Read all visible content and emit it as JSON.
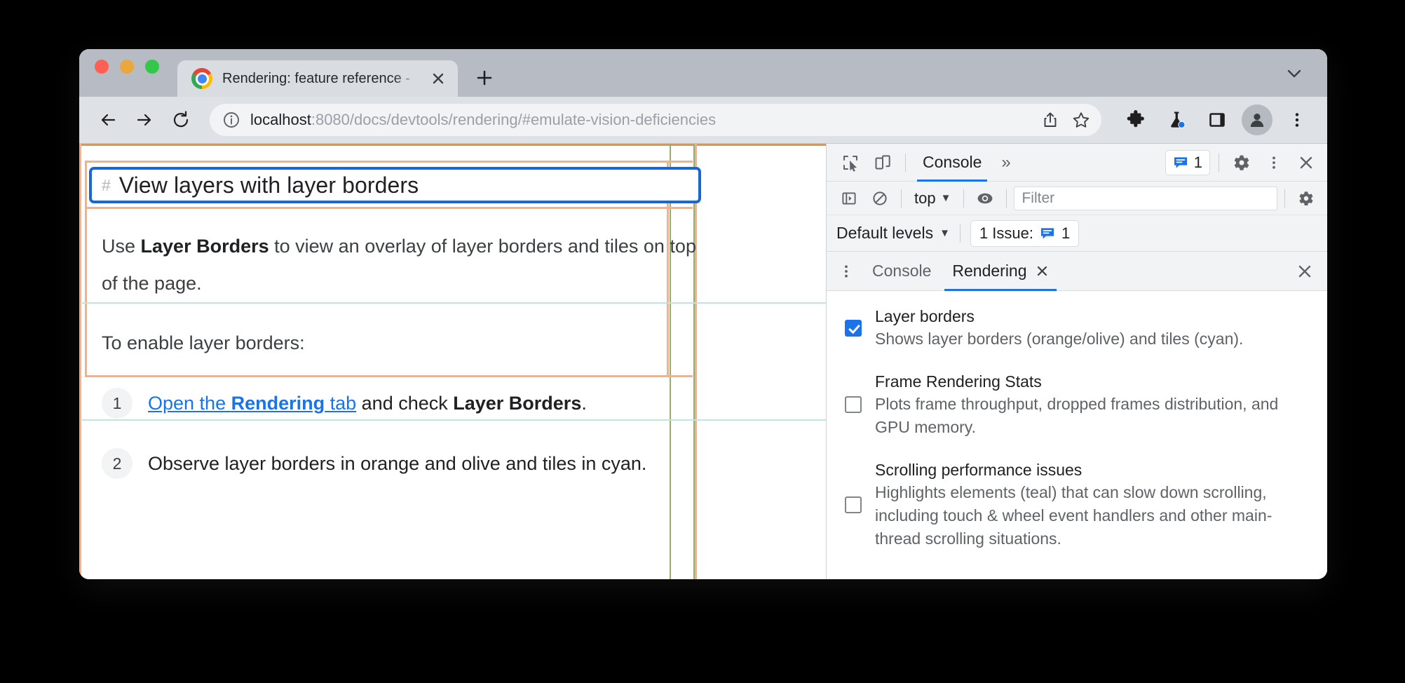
{
  "window": {
    "traffic_lights": [
      "close",
      "minimize",
      "zoom"
    ],
    "tab": {
      "title": "Rendering: feature reference -",
      "favicon": "chrome-logo",
      "close_label": "✕"
    },
    "new_tab_label": "+",
    "tab_list_caret": "⌄"
  },
  "toolbar": {
    "back": "←",
    "forward": "→",
    "reload": "⟳",
    "omnibox": {
      "info_icon": "info-icon",
      "url_host": "localhost",
      "url_rest": ":8080/docs/devtools/rendering/#emulate-vision-deficiencies",
      "full_url": "localhost:8080/docs/devtools/rendering/#emulate-vision-deficiencies",
      "share_icon": "share-icon",
      "bookmark_icon": "star-icon"
    },
    "extensions_icon": "puzzle-icon",
    "labs_icon": "flask-icon",
    "side_panel_icon": "side-panel-icon",
    "profile_icon": "avatar-icon",
    "menu_icon": "three-dot-icon"
  },
  "page": {
    "heading": {
      "anchor": "#",
      "text": "View layers with layer borders"
    },
    "paragraph_1": {
      "pre": "Use ",
      "strong": "Layer Borders",
      "post": " to view an overlay of layer borders and tiles on top of the page."
    },
    "paragraph_2": "To enable layer borders:",
    "steps": [
      {
        "marker": "1",
        "link_pre": "Open the ",
        "link_strong": "Rendering",
        "link_post": " tab",
        "mid": " and check ",
        "strong": "Layer Borders",
        "end": "."
      },
      {
        "marker": "2",
        "text": "Observe layer borders in orange and olive and tiles in cyan."
      }
    ],
    "overlay_colors": {
      "layer_border_orange": "#f0922f",
      "layer_border_orange_light": "#f5b183",
      "layer_border_olive": "#9aab6b",
      "tile_cyan": "#bfe4e1",
      "focus_blue": "#1967d2"
    }
  },
  "devtools": {
    "toolbar": {
      "inspect_icon": "inspect-cursor-icon",
      "device_icon": "device-toolbar-icon",
      "active_panel": "Console",
      "more_panels": "»",
      "issues_count": "1",
      "settings_icon": "gear-icon",
      "menu_icon": "three-dot-icon",
      "close_icon": "close-icon"
    },
    "console_filterbar": {
      "sidebar_icon": "console-sidebar-icon",
      "clear_icon": "clear-console-icon",
      "context": "top",
      "eye_icon": "live-expression-icon",
      "filter_placeholder": "Filter",
      "filter_value": "",
      "settings_icon": "gear-icon"
    },
    "console_levelbar": {
      "levels": "Default levels",
      "issue_text": "1 Issue:",
      "issue_icon": "issue-icon",
      "issue_count": "1"
    },
    "drawer": {
      "menu_icon": "three-dot-icon",
      "tabs": [
        {
          "label": "Console",
          "active": false,
          "closable": false
        },
        {
          "label": "Rendering",
          "active": true,
          "closable": true,
          "close_label": "✕"
        }
      ],
      "close_icon": "close-icon"
    },
    "rendering_options": [
      {
        "title": "Layer borders",
        "description": "Shows layer borders (orange/olive) and tiles (cyan).",
        "checked": true
      },
      {
        "title": "Frame Rendering Stats",
        "description": "Plots frame throughput, dropped frames distribution, and GPU memory.",
        "checked": false
      },
      {
        "title": "Scrolling performance issues",
        "description": "Highlights elements (teal) that can slow down scrolling, including touch & wheel event handlers and other main-thread scrolling situations.",
        "checked": false
      }
    ]
  }
}
